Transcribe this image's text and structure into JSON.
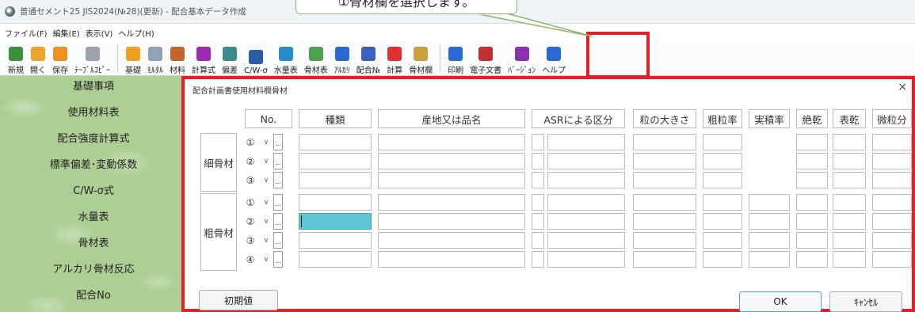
{
  "window": {
    "title": "普通セメント25 JIS2024(№28)(更新) - 配合基本データ作成"
  },
  "callout": {
    "text": "①骨材欄を選択します。"
  },
  "menu": [
    "ファイル(F)",
    "編集(E)",
    "表示(V)",
    "ヘルプ(H)"
  ],
  "toolbar": [
    {
      "label": "新規",
      "icon": "new-icon",
      "color": "#3a8f3a"
    },
    {
      "label": "開く",
      "icon": "open-icon",
      "color": "#e8a72b"
    },
    {
      "label": "保存",
      "icon": "save-icon",
      "color": "#f09020"
    },
    {
      "label": "ﾃｰﾌﾞﾙｺﾋﾟｰ",
      "icon": "table-copy-icon",
      "color": "#9aa3ad"
    },
    {
      "label": "基礎",
      "icon": "gear-icon",
      "color": "#f0a020"
    },
    {
      "label": "ﾓﾙﾀﾙ",
      "icon": "mortar-icon",
      "color": "#8fa2b6"
    },
    {
      "label": "材料",
      "icon": "material-icon",
      "color": "#c0662a"
    },
    {
      "label": "計算式",
      "icon": "formula-icon",
      "color": "#9b2bb0"
    },
    {
      "label": "偏差",
      "icon": "deviation-icon",
      "color": "#3a8b8b"
    },
    {
      "label": "C/W-σ",
      "icon": "cw-chart-icon",
      "color": "#2a5aa8"
    },
    {
      "label": "水量表",
      "icon": "water-icon",
      "color": "#2a8ad0"
    },
    {
      "label": "骨材表",
      "icon": "aggregate-table-icon",
      "color": "#50a050"
    },
    {
      "label": "ｱﾙｶﾘ",
      "icon": "asr-icon",
      "color": "#2a6ad0"
    },
    {
      "label": "配合№",
      "icon": "mix-no-icon",
      "color": "#3a60c0"
    },
    {
      "label": "計算",
      "icon": "check-icon",
      "color": "#e03030"
    },
    {
      "label": "骨材欄",
      "icon": "aggregate-column-icon",
      "color": "#c8a040"
    },
    {
      "label": "印刷",
      "icon": "print-icon",
      "color": "#2a6ad0"
    },
    {
      "label": "電子文書",
      "icon": "document-icon",
      "color": "#c03030"
    },
    {
      "label": "ﾊﾞｰｼﾞｮﾝ",
      "icon": "info-icon",
      "color": "#8a30b0"
    },
    {
      "label": "ヘルプ",
      "icon": "help-icon",
      "color": "#2a6ad0"
    }
  ],
  "sidebar": [
    "基礎事項",
    "使用材料表",
    "配合強度計算式",
    "標準偏差･変動係数",
    "C/W-σ式",
    "水量表",
    "骨材表",
    "アルカリ骨材反応",
    "配合No"
  ],
  "dialog": {
    "title": "配合計画書使用材料欄骨材",
    "close": "×",
    "headers": [
      "No.",
      "種類",
      "産地又は品名",
      "ASRによる区分",
      "粒の大きさ",
      "粗粒率",
      "実積率",
      "絶乾",
      "表乾",
      "微粒分"
    ],
    "groups": [
      {
        "label": "細骨材",
        "rows": [
          "①",
          "②",
          "③"
        ]
      },
      {
        "label": "粗骨材",
        "rows": [
          "①",
          "②",
          "③",
          "④"
        ]
      }
    ],
    "dropdown": "∨",
    "dots": "...",
    "reset_label": "初期値",
    "ok_label": "OK",
    "cancel_label": "ｷｬﾝｾﾙ"
  }
}
